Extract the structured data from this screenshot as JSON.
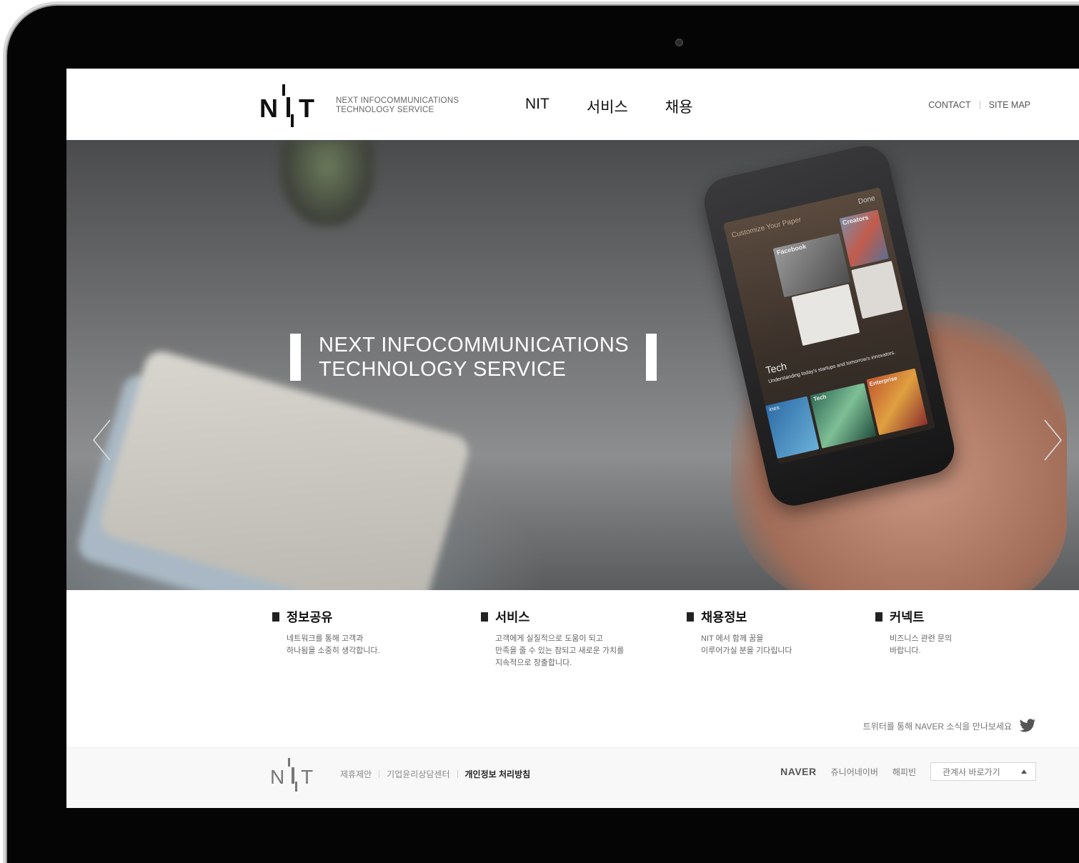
{
  "header": {
    "logo_text": "N'I,T",
    "logo_sub_line1": "NEXT INFOCOMMUNICATIONS",
    "logo_sub_line2": "TECHNOLOGY SERVICE",
    "nav": [
      {
        "label": "NIT"
      },
      {
        "label": "서비스"
      },
      {
        "label": "채용"
      }
    ],
    "util_contact": "CONTACT",
    "util_sitemap": "SITE MAP"
  },
  "hero": {
    "title_line1": "NEXT INFOCOMMUNICATIONS",
    "title_line2": "TECHNOLOGY SERVICE",
    "phone": {
      "top_left": "Customize Your Paper",
      "done": "Done",
      "facebook": "Facebook",
      "creators": "Creators",
      "tech_heading": "Tech",
      "tech_desc": "Understanding today's startups and tomorrow's innovators.",
      "tile_tech": "Tech",
      "tile_enterprise": "Enterprise",
      "tile_ines": "ines"
    },
    "prev_icon": "chevron-left",
    "next_icon": "chevron-right"
  },
  "features": [
    {
      "title": "정보공유",
      "desc": [
        "네트워크를 통해 고객과",
        "하나됨을 소중히 생각합니다."
      ]
    },
    {
      "title": "서비스",
      "desc": [
        "고객에게 실질적으로 도움이 되고",
        "만족을 줄 수 있는 참되고 새로운 가치를",
        "지속적으로 창출합니다."
      ]
    },
    {
      "title": "채용정보",
      "desc": [
        "NIT 에서 함께 꿈을",
        "이루어가실 분을 기다립니다"
      ]
    },
    {
      "title": "커넥트",
      "desc": [
        "비즈니스 관련 문의",
        "바랍니다."
      ]
    }
  ],
  "twitter_text": "트위터를 통해 NAVER 소식을 만나보세요",
  "footer": {
    "links": [
      "제휴제안",
      "기업윤리상담센터",
      "개인정보 처리방침"
    ],
    "naver": "NAVER",
    "item1": "쥬니어네이버",
    "item2": "해피빈",
    "select_value": "관계사 바로가기"
  }
}
